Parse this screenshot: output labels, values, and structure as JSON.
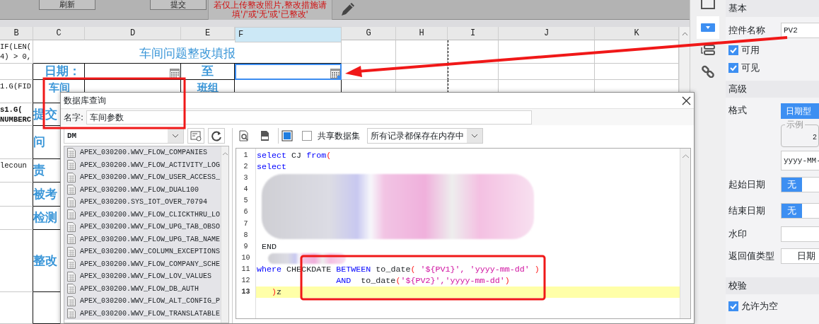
{
  "toolbar": {
    "buttons": [
      "刷新",
      "提交"
    ],
    "note": [
      "若仅上传整改照片,整改措施请",
      "填'/'或'无'或'已整改'"
    ]
  },
  "sheet": {
    "columns": [
      {
        "label": "B",
        "selected": false
      },
      {
        "label": "C",
        "selected": false
      },
      {
        "label": "D",
        "selected": false
      },
      {
        "label": "E",
        "selected": false
      },
      {
        "label": "F",
        "selected": true
      },
      {
        "label": "G",
        "selected": false
      },
      {
        "label": "H",
        "selected": false
      },
      {
        "label": "I",
        "selected": false
      },
      {
        "label": "J",
        "selected": false
      },
      {
        "label": "K",
        "selected": false
      }
    ],
    "rows": [
      {
        "column_b": [
          "IF(LEN(",
          "4) > 0,"
        ],
        "bold_b": false,
        "title": "车间问题整改填报"
      },
      {
        "label": "日期：",
        "date_from": {
          "selected": false
        },
        "separator": "至",
        "date_to": {
          "selected": true
        }
      },
      {
        "column_b": [
          "1.G(FID"
        ],
        "bold_b": false,
        "label": "车间",
        "label_e": "班组"
      },
      {
        "column_b": [
          "s1.G(",
          "NUMBERC"
        ],
        "bold_b": true,
        "label": "提交"
      },
      {
        "label": "问"
      },
      {
        "column_b": [
          "lecoun"
        ],
        "bold_b": false,
        "label": "责"
      },
      {
        "label": "被考"
      },
      {
        "label": "检测"
      },
      {
        "label": "整改"
      }
    ]
  },
  "dialog": {
    "title": "数据库查询",
    "name_label": "名字:",
    "name_value": "车间参数",
    "database": "DM",
    "tables": [
      "APEX_030200.WWV_FLOW_COMPANIES",
      "APEX_030200.WWV_FLOW_ACTIVITY_LOG",
      "APEX_030200.WWV_FLOW_USER_ACCESS_",
      "APEX_030200.WWV_FLOW_DUAL100",
      "APEX_030200.SYS_IOT_OVER_70794",
      "APEX_030200.WWV_FLOW_CLICKTHRU_LO",
      "APEX_030200.WWV_FLOW_UPG_TAB_OBSO",
      "APEX_030200.WWV_FLOW_UPG_TAB_NAME",
      "APEX_030200.WWV_COLUMN_EXCEPTIONS",
      "APEX_030200.WWV_FLOW_COMPANY_SCHE",
      "APEX_030200.WWV_FLOW_LOV_VALUES",
      "APEX_030200.WWV_FLOW_DB_AUTH",
      "APEX_030200.WWV_FLOW_ALT_CONFIG_P",
      "APEX_030200.WWV_FLOW_TRANSLATABLE"
    ],
    "share_dataset": {
      "label": "共享数据集",
      "checked": false
    },
    "storage": "所有记录都保存在内存中",
    "code_lines": [
      {
        "number": "1",
        "current": false,
        "tokens": [
          {
            "text": "select",
            "kind": "keyword"
          },
          {
            "text": " CJ ",
            "kind": "plain"
          },
          {
            "text": "from",
            "kind": "keyword"
          },
          {
            "text": "(",
            "kind": "paren"
          }
        ]
      },
      {
        "number": "2",
        "current": false,
        "tokens": [
          {
            "text": "select",
            "kind": "keyword"
          }
        ]
      },
      {
        "number": "3",
        "current": false
      },
      {
        "number": "4",
        "current": false
      },
      {
        "number": "5",
        "current": false
      },
      {
        "number": "6",
        "current": false
      },
      {
        "number": "7",
        "current": false
      },
      {
        "number": "8",
        "current": false
      },
      {
        "number": "9",
        "current": false,
        "tokens": [
          {
            "text": " END",
            "kind": "plain"
          }
        ]
      },
      {
        "number": "10",
        "current": false
      },
      {
        "number": "11",
        "current": false,
        "tokens": [
          {
            "text": "where",
            "kind": "keyword"
          },
          {
            "text": " CHECKDATE ",
            "kind": "plain"
          },
          {
            "text": "BETWEEN",
            "kind": "keyword"
          },
          {
            "text": " to_date",
            "kind": "plain"
          },
          {
            "text": "(",
            "kind": "paren"
          },
          {
            "text": " '${PV1}', 'yyyy-mm-dd' ",
            "kind": "string"
          },
          {
            "text": ")",
            "kind": "paren"
          }
        ]
      },
      {
        "number": "12",
        "current": false,
        "tokens": [
          {
            "text": "                AND",
            "kind": "keyword"
          },
          {
            "text": "  to_date",
            "kind": "plain"
          },
          {
            "text": "(",
            "kind": "paren"
          },
          {
            "text": "'${PV2}','yyyy-mm-dd'",
            "kind": "string"
          },
          {
            "text": ")",
            "kind": "paren"
          }
        ]
      },
      {
        "number": "13",
        "current": true,
        "tokens": [
          {
            "text": "   )",
            "kind": "paren"
          },
          {
            "text": "z",
            "kind": "plain"
          }
        ]
      }
    ]
  },
  "properties": {
    "sections": [
      {
        "title": "基本",
        "rows": [
          {
            "kind": "input",
            "label": "控件名称",
            "value": "PV2"
          },
          {
            "kind": "checkbox",
            "label": "可用",
            "checked": true
          },
          {
            "kind": "checkbox",
            "label": "可见",
            "checked": true
          }
        ]
      },
      {
        "title": "高级",
        "rows": [
          {
            "kind": "button",
            "label": "格式",
            "value": "日期型"
          },
          {
            "kind": "example",
            "legend": "示例",
            "value": "2"
          },
          {
            "kind": "input",
            "value": "yyyy-MM-"
          },
          {
            "kind": "toggle",
            "label": "起始日期",
            "options": [
              {
                "label": "无",
                "selected": true
              },
              {
                "selected": false
              }
            ]
          },
          {
            "kind": "toggle",
            "label": "结束日期",
            "options": [
              {
                "label": "无",
                "selected": true
              },
              {
                "selected": false
              }
            ]
          },
          {
            "kind": "input",
            "label": "水印"
          },
          {
            "kind": "select",
            "label": "返回值类型",
            "value": "日期"
          }
        ]
      },
      {
        "title": "校验",
        "rows": [
          {
            "kind": "checkbox",
            "label": "允许为空",
            "checked": true
          }
        ]
      }
    ]
  }
}
